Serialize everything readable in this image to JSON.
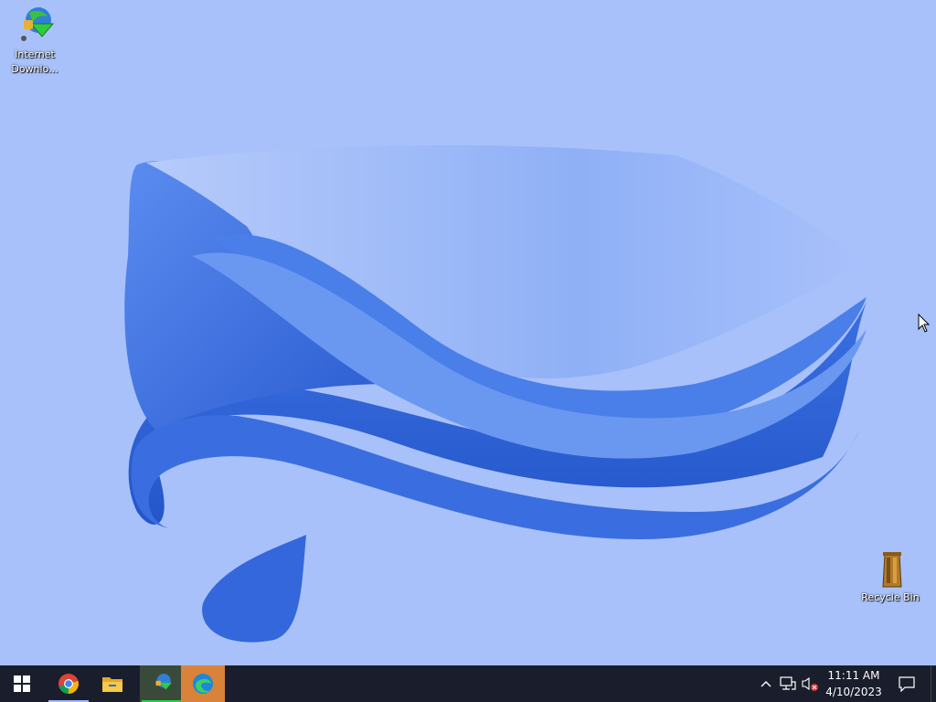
{
  "desktop": {
    "icons": [
      {
        "name": "Internet\nDownlo...",
        "icon": "internet-download-manager-icon"
      },
      {
        "name": "Recycle Bin",
        "icon": "recycle-bin-icon"
      }
    ]
  },
  "taskbar": {
    "start": {
      "icon": "windows-logo-icon"
    },
    "pinned": [
      {
        "app": "Google Chrome",
        "icon": "chrome-icon"
      },
      {
        "app": "File Explorer",
        "icon": "folder-icon"
      },
      {
        "app": "Internet Download Manager",
        "icon": "idm-icon"
      },
      {
        "app": "Microsoft Edge",
        "icon": "edge-icon"
      }
    ],
    "tray": {
      "icons": [
        "chevron-up-icon",
        "network-icon",
        "volume-muted-icon"
      ],
      "time": "11:11 AM",
      "date": "4/10/2023",
      "notification_icon": "action-center-icon"
    }
  },
  "colors": {
    "desktop_bg": "#a9c1fb",
    "taskbar_bg": "#1a1e2c",
    "ribbon": "#3a6ee0"
  }
}
